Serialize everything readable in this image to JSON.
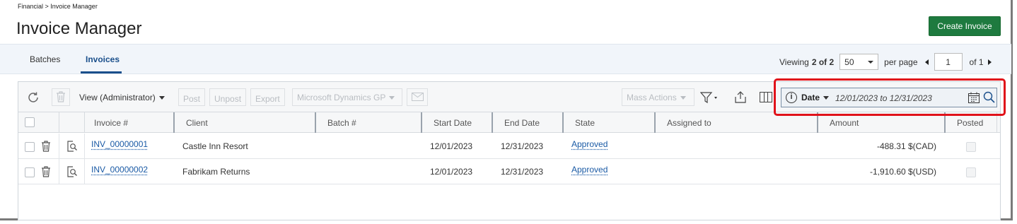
{
  "breadcrumb": "Financial > Invoice Manager",
  "page_title": "Invoice Manager",
  "create_button": "Create Invoice",
  "tabs": [
    {
      "label": "Batches",
      "active": false
    },
    {
      "label": "Invoices",
      "active": true
    }
  ],
  "pager": {
    "viewing_label": "Viewing",
    "viewing_count": "2 of 2",
    "per_page_value": "50",
    "per_page_label": "per page",
    "page": "1",
    "of_label": "of 1"
  },
  "toolbar": {
    "view_label": "View (Administrator)",
    "post": "Post",
    "unpost": "Unpost",
    "export": "Export",
    "integration": "Microsoft Dynamics GP",
    "mass_actions": "Mass Actions"
  },
  "date_filter": {
    "field": "Date",
    "range": "12/01/2023 to 12/31/2023"
  },
  "columns": [
    "Invoice #",
    "Client",
    "Batch #",
    "Start Date",
    "End Date",
    "State",
    "Assigned to",
    "Amount",
    "Posted"
  ],
  "rows": [
    {
      "invoice": "INV_00000001",
      "client": "Castle Inn Resort",
      "batch": "",
      "start": "12/01/2023",
      "end": "12/31/2023",
      "state": "Approved",
      "assigned": "",
      "amount": "-488.31 $(CAD)"
    },
    {
      "invoice": "INV_00000002",
      "client": "Fabrikam Returns",
      "batch": "",
      "start": "12/01/2023",
      "end": "12/31/2023",
      "state": "Approved",
      "assigned": "",
      "amount": "-1,910.60 $(USD)"
    }
  ],
  "colors": {
    "accent": "#1a4f8b",
    "create_button": "#1e7a3f",
    "highlight": "#e0121a",
    "link": "#1a5aa5"
  }
}
